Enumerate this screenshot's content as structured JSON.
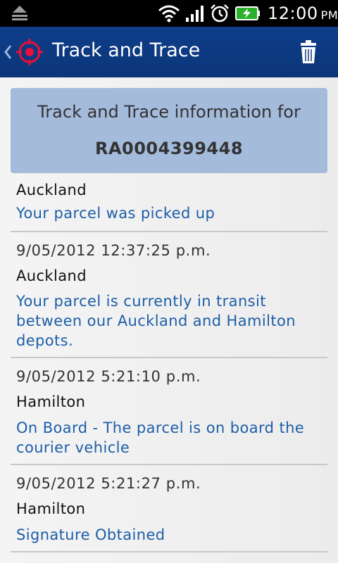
{
  "status_bar": {
    "time": "12:00",
    "ampm": "PM",
    "icons": [
      "notification-icon",
      "wifi-icon",
      "signal-icon",
      "alarm-icon",
      "battery-charging-icon"
    ]
  },
  "action_bar": {
    "title": "Track and Trace",
    "accent_color": "#0e3e8a",
    "logo_color": "#e8103a"
  },
  "info_panel": {
    "heading": "Track and Trace information for",
    "tracking_number": "RA0004399448",
    "background": "#a4bbdc"
  },
  "events": [
    {
      "timestamp": "",
      "location": "Auckland",
      "description": "Your parcel was picked up"
    },
    {
      "timestamp": "9/05/2012 12:37:25 p.m.",
      "location": "Auckland",
      "description_lines": [
        "Your parcel is currently in transit",
        "between our Auckland and Hamilton",
        "depots."
      ]
    },
    {
      "timestamp": "9/05/2012 5:21:10 p.m.",
      "location": "Hamilton",
      "description_lines": [
        "On Board - The parcel is on board the",
        "courier vehicle"
      ]
    },
    {
      "timestamp": "9/05/2012 5:21:27 p.m.",
      "location": "Hamilton",
      "description": "Signature Obtained"
    }
  ]
}
